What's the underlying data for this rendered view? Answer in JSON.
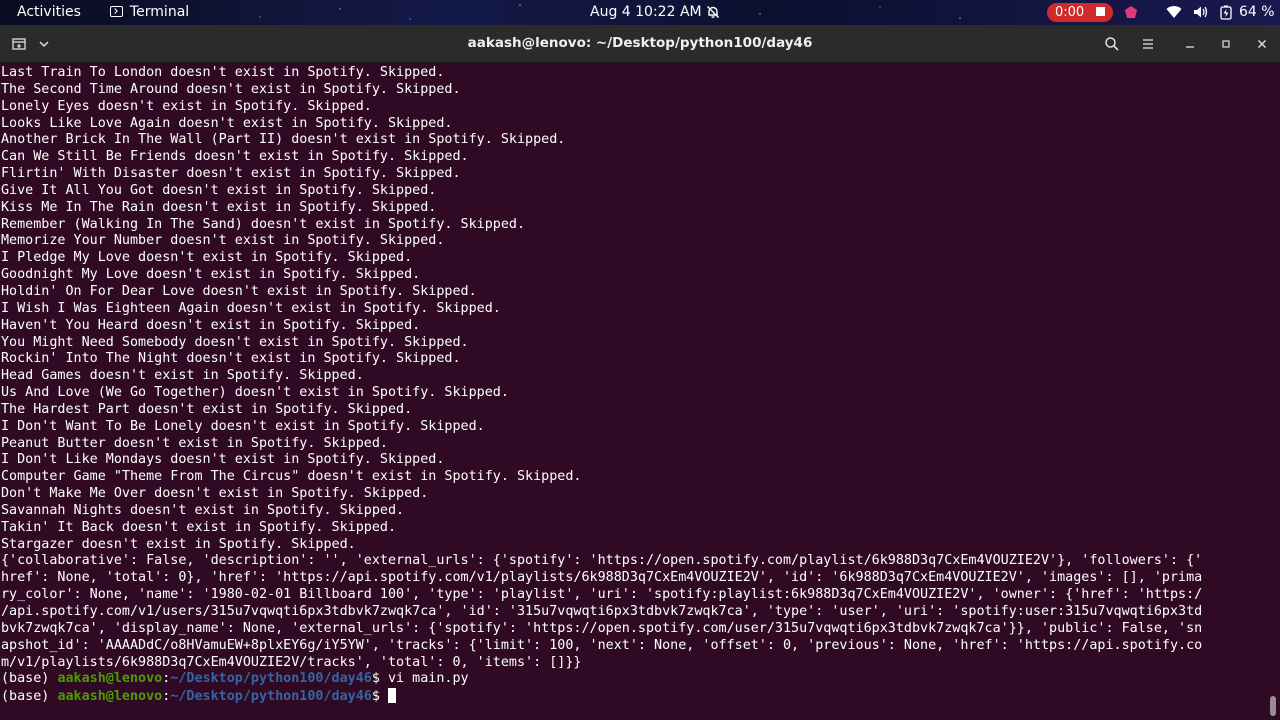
{
  "topbar": {
    "activities": "Activities",
    "app_name": "Terminal",
    "clock": "Aug 4  10:22 AM",
    "recording_time": "0:00",
    "battery": "64 %"
  },
  "window": {
    "title": "aakash@lenovo: ~/Desktop/python100/day46"
  },
  "terminal": {
    "output_lines": [
      "Last Train To London doesn't exist in Spotify. Skipped.",
      "The Second Time Around doesn't exist in Spotify. Skipped.",
      "Lonely Eyes doesn't exist in Spotify. Skipped.",
      "Looks Like Love Again doesn't exist in Spotify. Skipped.",
      "Another Brick In The Wall (Part II) doesn't exist in Spotify. Skipped.",
      "Can We Still Be Friends doesn't exist in Spotify. Skipped.",
      "Flirtin' With Disaster doesn't exist in Spotify. Skipped.",
      "Give It All You Got doesn't exist in Spotify. Skipped.",
      "Kiss Me In The Rain doesn't exist in Spotify. Skipped.",
      "Remember (Walking In The Sand) doesn't exist in Spotify. Skipped.",
      "Memorize Your Number doesn't exist in Spotify. Skipped.",
      "I Pledge My Love doesn't exist in Spotify. Skipped.",
      "Goodnight My Love doesn't exist in Spotify. Skipped.",
      "Holdin' On For Dear Love doesn't exist in Spotify. Skipped.",
      "I Wish I Was Eighteen Again doesn't exist in Spotify. Skipped.",
      "Haven't You Heard doesn't exist in Spotify. Skipped.",
      "You Might Need Somebody doesn't exist in Spotify. Skipped.",
      "Rockin' Into The Night doesn't exist in Spotify. Skipped.",
      "Head Games doesn't exist in Spotify. Skipped.",
      "Us And Love (We Go Together) doesn't exist in Spotify. Skipped.",
      "The Hardest Part doesn't exist in Spotify. Skipped.",
      "I Don't Want To Be Lonely doesn't exist in Spotify. Skipped.",
      "Peanut Butter doesn't exist in Spotify. Skipped.",
      "I Don't Like Mondays doesn't exist in Spotify. Skipped.",
      "Computer Game \"Theme From The Circus\" doesn't exist in Spotify. Skipped.",
      "Don't Make Me Over doesn't exist in Spotify. Skipped.",
      "Savannah Nights doesn't exist in Spotify. Skipped.",
      "Takin' It Back doesn't exist in Spotify. Skipped.",
      "Stargazer doesn't exist in Spotify. Skipped.",
      "{'collaborative': False, 'description': '', 'external_urls': {'spotify': 'https://open.spotify.com/playlist/6k988D3q7CxEm4VOUZIE2V'}, 'followers': {'",
      "href': None, 'total': 0}, 'href': 'https://api.spotify.com/v1/playlists/6k988D3q7CxEm4VOUZIE2V', 'id': '6k988D3q7CxEm4VOUZIE2V', 'images': [], 'prima",
      "ry_color': None, 'name': '1980-02-01 Billboard 100', 'type': 'playlist', 'uri': 'spotify:playlist:6k988D3q7CxEm4VOUZIE2V', 'owner': {'href': 'https:/",
      "/api.spotify.com/v1/users/315u7vqwqti6px3tdbvk7zwqk7ca', 'id': '315u7vqwqti6px3tdbvk7zwqk7ca', 'type': 'user', 'uri': 'spotify:user:315u7vqwqti6px3td",
      "bvk7zwqk7ca', 'display_name': None, 'external_urls': {'spotify': 'https://open.spotify.com/user/315u7vqwqti6px3tdbvk7zwqk7ca'}}, 'public': False, 'sn",
      "apshot_id': 'AAAADdC/o8HVamuEW+8plxEY6g/iY5YW', 'tracks': {'limit': 100, 'next': None, 'offset': 0, 'previous': None, 'href': 'https://api.spotify.co",
      "m/v1/playlists/6k988D3q7CxEm4VOUZIE2V/tracks', 'total': 0, 'items': []}}"
    ],
    "prompt": {
      "env": "(base) ",
      "user_host": "aakash@lenovo",
      "sep": ":",
      "path": "~/Desktop/python100/day46",
      "dollar": "$"
    },
    "previous_command": " vi main.py",
    "current_command": ""
  }
}
